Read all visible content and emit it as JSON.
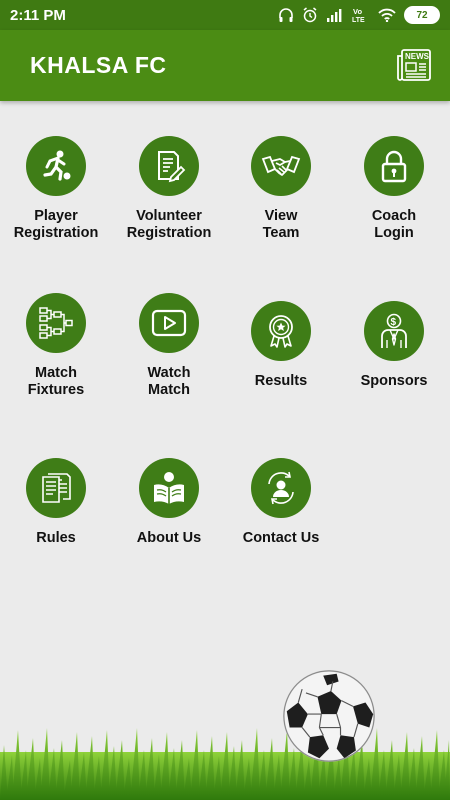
{
  "status": {
    "time": "2:11 PM",
    "battery": "72",
    "network_label": "Vo LTE"
  },
  "header": {
    "title": "KHALSA FC",
    "news_icon_text": "NEWS"
  },
  "menu": [
    {
      "label": "Player\nRegistration",
      "icon": "player-kick-icon"
    },
    {
      "label": "Volunteer\nRegistration",
      "icon": "document-edit-icon"
    },
    {
      "label": "View\nTeam",
      "icon": "handshake-icon"
    },
    {
      "label": "Coach\nLogin",
      "icon": "lock-icon"
    },
    {
      "label": "Match\nFixtures",
      "icon": "bracket-icon"
    },
    {
      "label": "Watch\nMatch",
      "icon": "video-play-icon"
    },
    {
      "label": "Results",
      "icon": "award-badge-icon"
    },
    {
      "label": "Sponsors",
      "icon": "businessman-dollar-icon"
    },
    {
      "label": "Rules",
      "icon": "pages-icon"
    },
    {
      "label": "About Us",
      "icon": "reader-icon"
    },
    {
      "label": "Contact Us",
      "icon": "contact-person-icon"
    }
  ],
  "colors": {
    "primary": "#4b8c14",
    "status_bar": "#3f7a12",
    "icon_circle": "#3f7d17",
    "background": "#ebebeb"
  }
}
